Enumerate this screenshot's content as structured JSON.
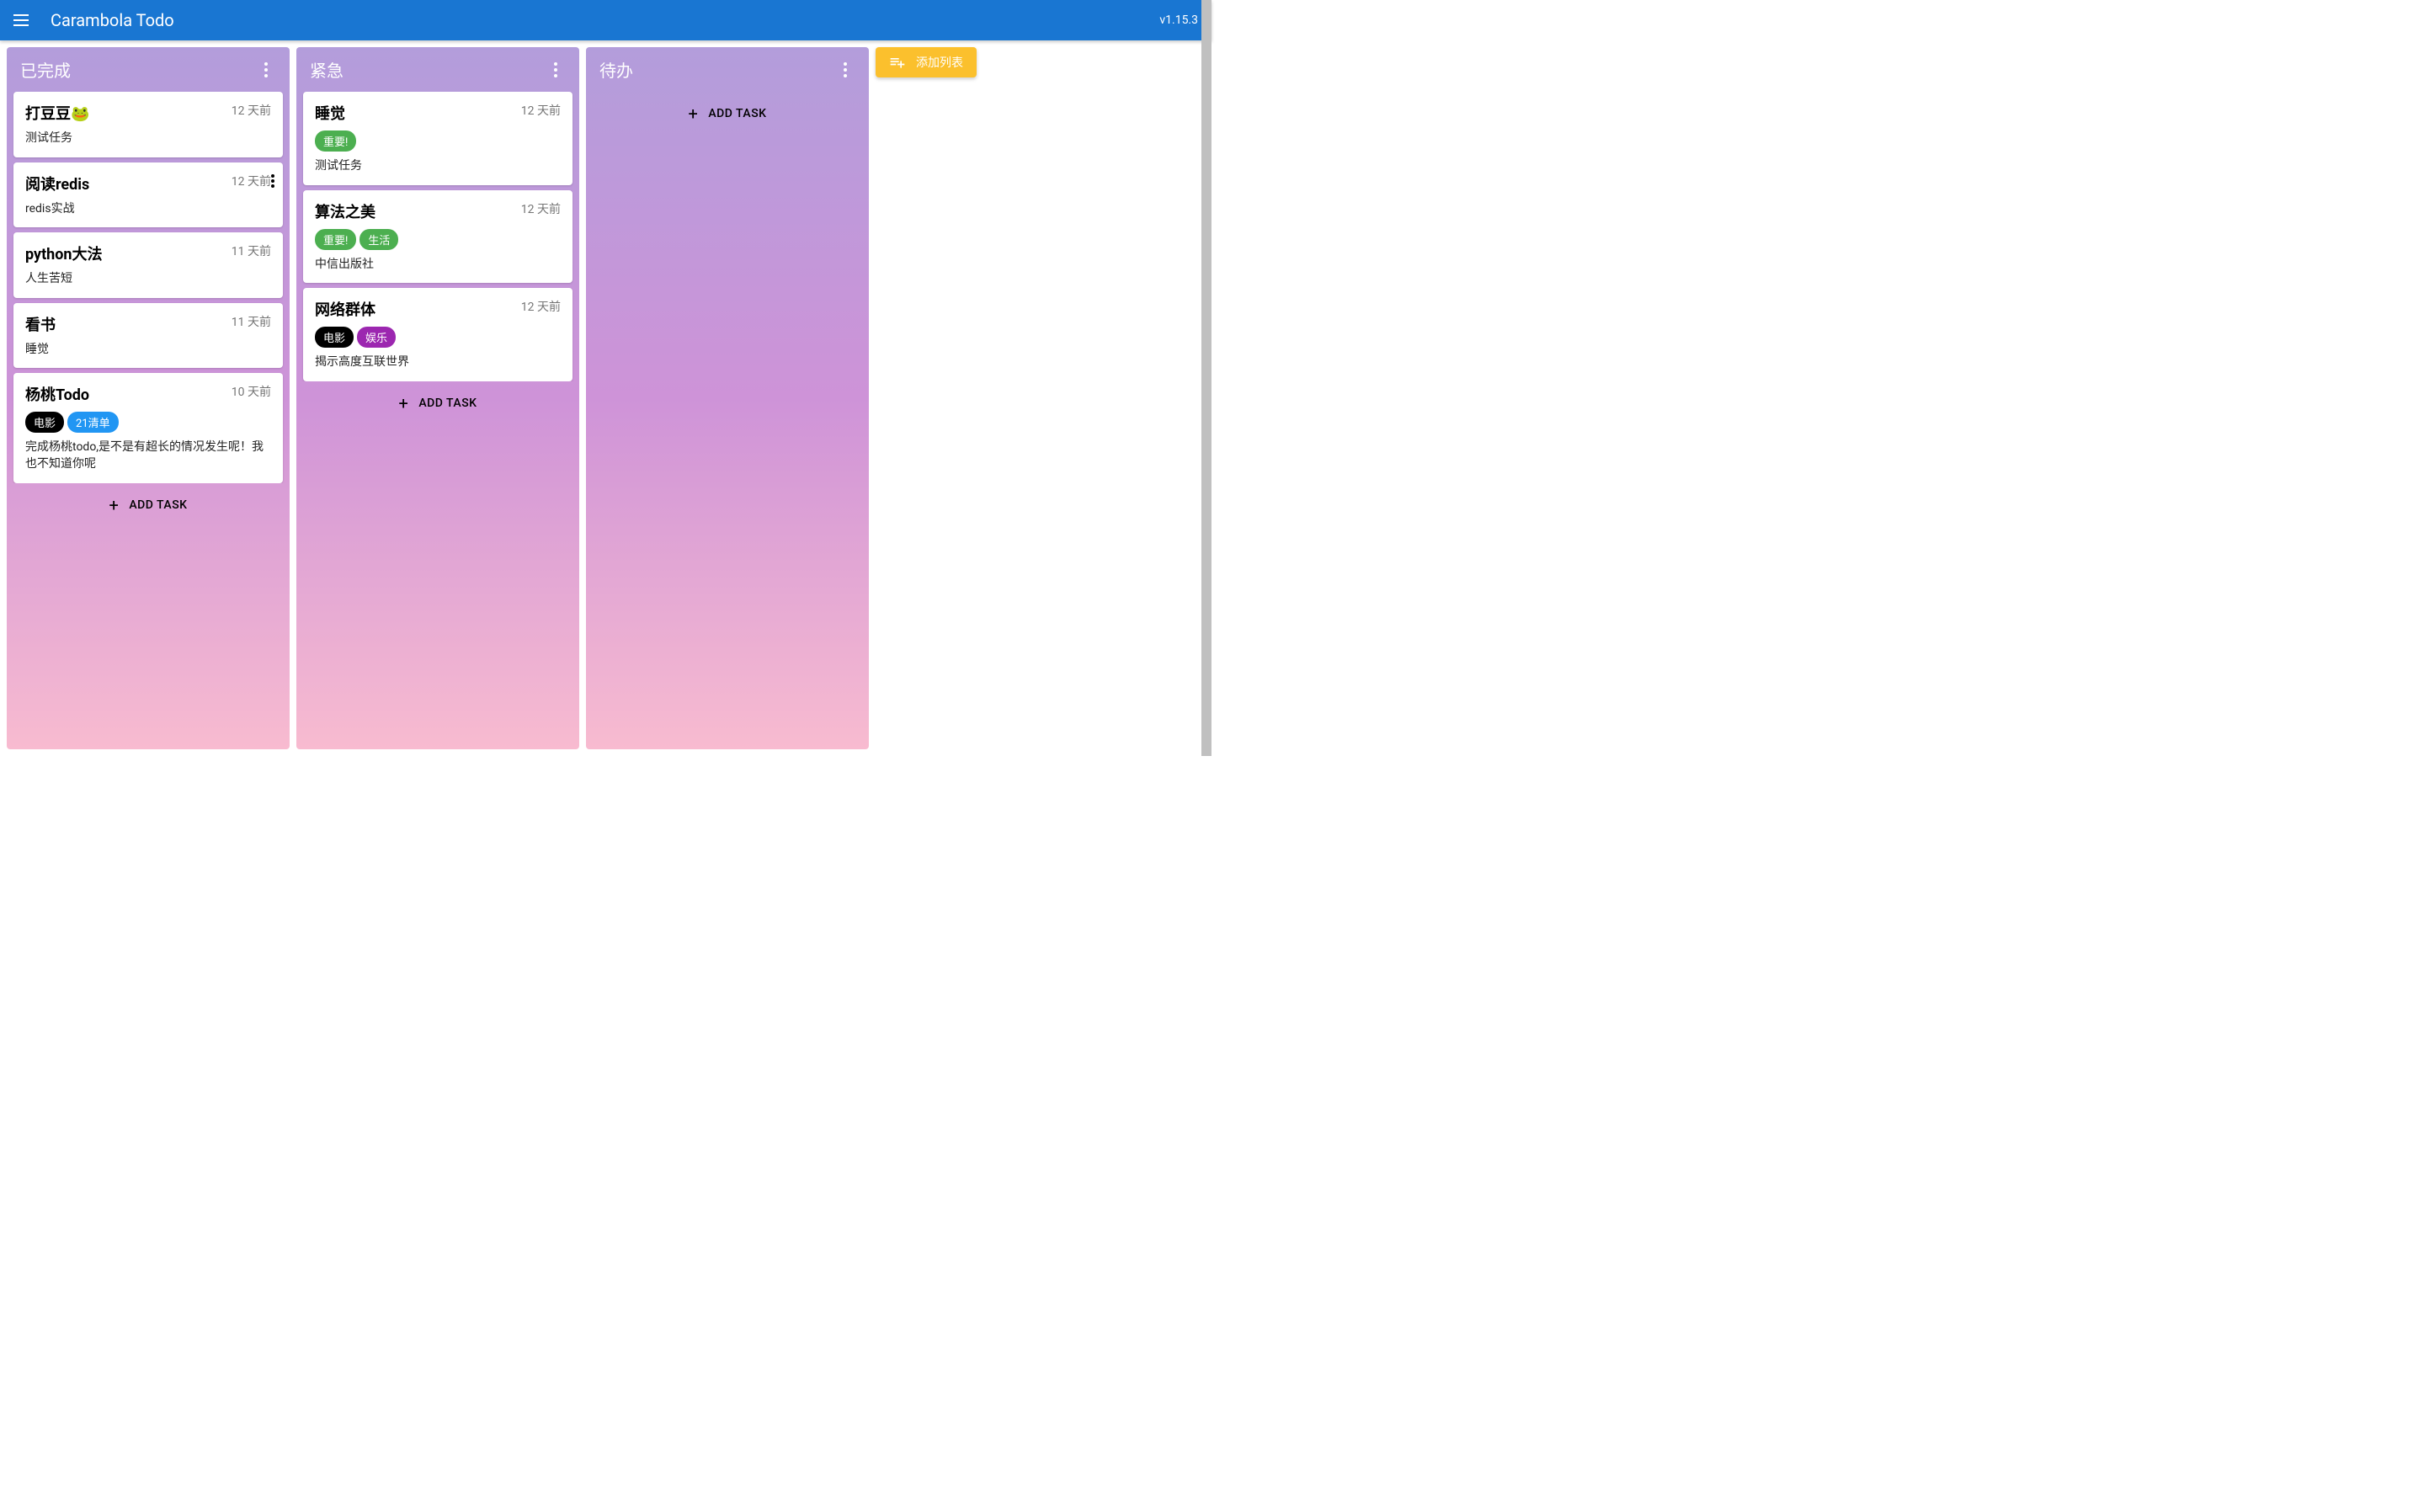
{
  "header": {
    "title": "Carambola Todo",
    "version": "v1.15.3"
  },
  "addColumnLabel": "添加列表",
  "addTaskLabel": "ADD TASK",
  "tagColors": {
    "important": "#4caf50",
    "life": "#4caf50",
    "movie": "#000000",
    "entertainment": "#9c27b0",
    "list21": "#2196f3"
  },
  "columns": [
    {
      "title": "已完成",
      "cards": [
        {
          "title": "打豆豆🐸",
          "time": "12 天前",
          "tags": [],
          "desc": "测试任务",
          "showMore": false
        },
        {
          "title": "阅读redis",
          "time": "12 天前",
          "tags": [],
          "desc": "redis实战",
          "showMore": true
        },
        {
          "title": "python大法",
          "time": "11 天前",
          "tags": [],
          "desc": "人生苦短",
          "showMore": false
        },
        {
          "title": "看书",
          "time": "11 天前",
          "tags": [],
          "desc": "睡觉",
          "showMore": false
        },
        {
          "title": "杨桃Todo",
          "time": "10 天前",
          "tags": [
            {
              "text": "电影",
              "color": "#000000"
            },
            {
              "text": "21清单",
              "color": "#2196f3"
            }
          ],
          "desc": "完成杨桃todo,是不是有超长的情况发生呢！我也不知道你呢",
          "showMore": false
        }
      ]
    },
    {
      "title": "紧急",
      "cards": [
        {
          "title": "睡觉",
          "time": "12 天前",
          "tags": [
            {
              "text": "重要!",
              "color": "#4caf50"
            }
          ],
          "desc": "测试任务",
          "showMore": false
        },
        {
          "title": "算法之美",
          "time": "12 天前",
          "tags": [
            {
              "text": "重要!",
              "color": "#4caf50"
            },
            {
              "text": "生活",
              "color": "#4caf50"
            }
          ],
          "desc": "中信出版社",
          "showMore": false
        },
        {
          "title": "网络群体",
          "time": "12 天前",
          "tags": [
            {
              "text": "电影",
              "color": "#000000"
            },
            {
              "text": "娱乐",
              "color": "#9c27b0"
            }
          ],
          "desc": "揭示高度互联世界",
          "showMore": false
        }
      ]
    },
    {
      "title": "待办",
      "cards": []
    }
  ]
}
